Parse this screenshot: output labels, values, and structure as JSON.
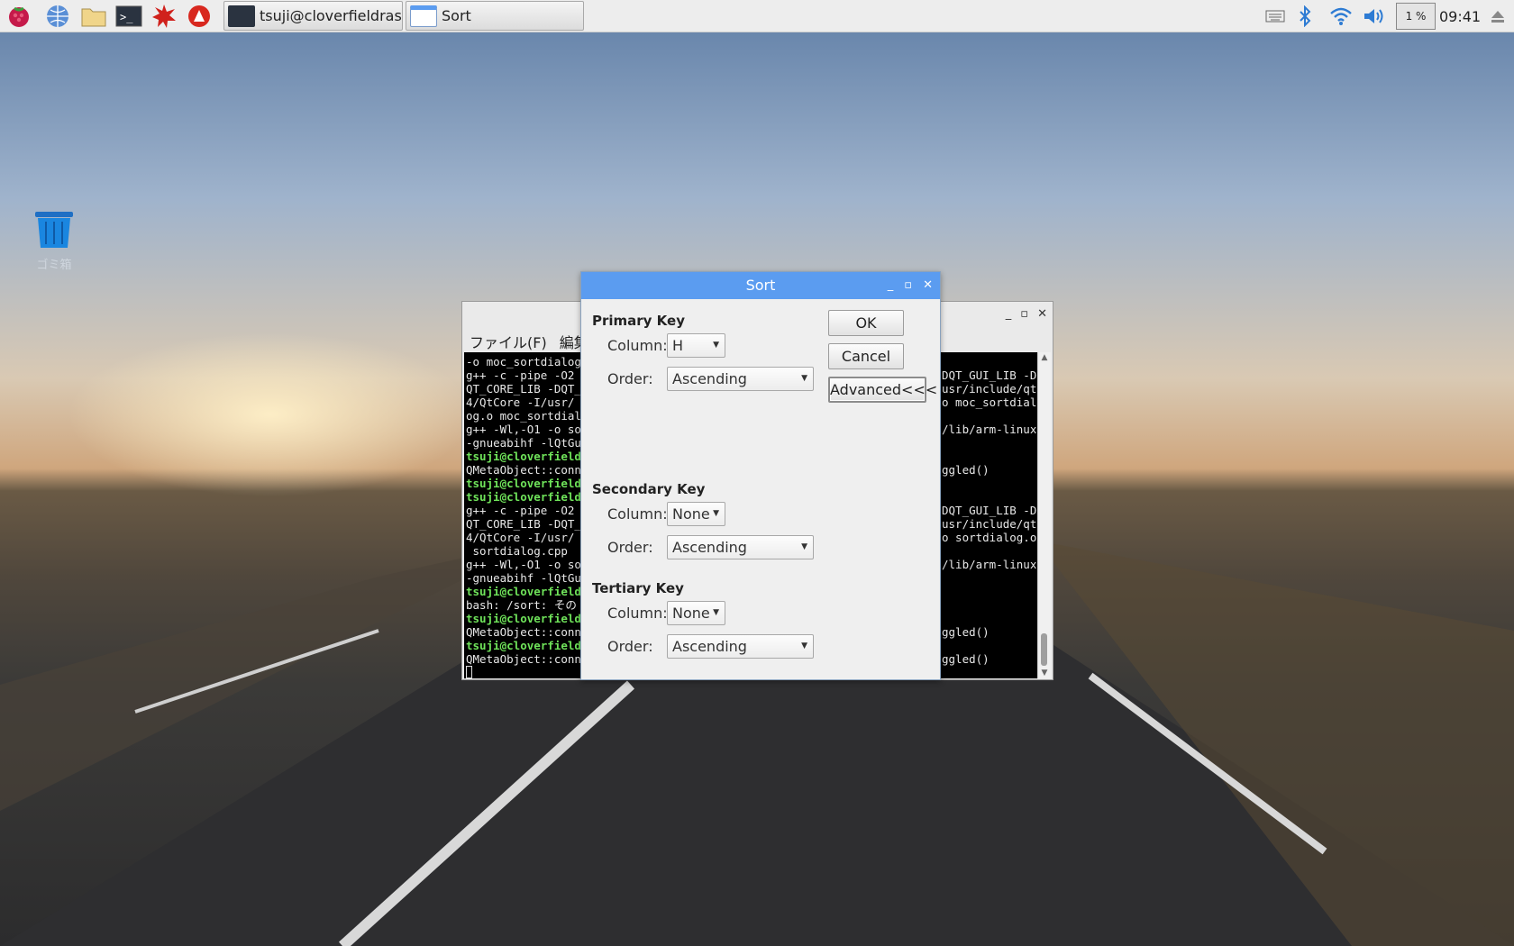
{
  "taskbar": {
    "tasks": [
      {
        "label": "tsuji@cloverfieldrasp..."
      },
      {
        "label": "Sort"
      }
    ],
    "cpu": "1 %",
    "clock": "09:41"
  },
  "desktop": {
    "trash_label": "ゴミ箱"
  },
  "terminal": {
    "menu": [
      "ファイル(F)",
      "編集"
    ],
    "left_lines": [
      {
        "t": "-o moc_sortdialog",
        "g": false
      },
      {
        "t": "g++ -c -pipe -O2",
        "g": false
      },
      {
        "t": "QT_CORE_LIB -DQT_",
        "g": false
      },
      {
        "t": "4/QtCore -I/usr/",
        "g": false
      },
      {
        "t": "og.o moc_sortdial",
        "g": false
      },
      {
        "t": "g++ -Wl,-O1 -o so",
        "g": false
      },
      {
        "t": "-gnueabihf -lQtGu",
        "g": false
      },
      {
        "t": "tsuji@cloverfield",
        "g": true
      },
      {
        "t": "QMetaObject::conn",
        "g": false
      },
      {
        "t": "tsuji@cloverfield",
        "g": true
      },
      {
        "t": "tsuji@cloverfield",
        "g": true
      },
      {
        "t": "g++ -c -pipe -O2",
        "g": false
      },
      {
        "t": "QT_CORE_LIB -DQT_",
        "g": false
      },
      {
        "t": "4/QtCore -I/usr/",
        "g": false
      },
      {
        "t": " sortdialog.cpp",
        "g": false
      },
      {
        "t": "g++ -Wl,-O1 -o so",
        "g": false
      },
      {
        "t": "-gnueabihf -lQtGu",
        "g": false
      },
      {
        "t": "tsuji@cloverfield",
        "g": true
      },
      {
        "t": "bash: /sort: その",
        "g": false
      },
      {
        "t": "tsuji@cloverfield",
        "g": true
      },
      {
        "t": "QMetaObject::conn",
        "g": false
      },
      {
        "t": "tsuji@cloverfield",
        "g": true
      },
      {
        "t": "QMetaObject::conn",
        "g": false
      }
    ],
    "right_lines": [
      {
        "row": 1,
        "t": "DQT_GUI_LIB -D"
      },
      {
        "row": 2,
        "t": "usr/include/qt"
      },
      {
        "row": 3,
        "t": "o moc_sortdial"
      },
      {
        "row": 5,
        "t": "/lib/arm-linux"
      },
      {
        "row": 8,
        "t": "ggled()"
      },
      {
        "row": 11,
        "t": "DQT_GUI_LIB -D"
      },
      {
        "row": 12,
        "t": "usr/include/qt"
      },
      {
        "row": 13,
        "t": "o sortdialog.o"
      },
      {
        "row": 15,
        "t": "/lib/arm-linux"
      },
      {
        "row": 20,
        "t": "ggled()"
      },
      {
        "row": 22,
        "t": "ggled()"
      }
    ]
  },
  "dialog": {
    "title": "Sort",
    "primary": {
      "heading": "Primary Key",
      "column_label": "Column:",
      "column_value": "H",
      "order_label": "Order:",
      "order_value": "Ascending"
    },
    "secondary": {
      "heading": "Secondary Key",
      "column_label": "Column:",
      "column_value": "None",
      "order_label": "Order:",
      "order_value": "Ascending"
    },
    "tertiary": {
      "heading": "Tertiary Key",
      "column_label": "Column:",
      "column_value": "None",
      "order_label": "Order:",
      "order_value": "Ascending"
    },
    "ok_label": "OK",
    "cancel_label": "Cancel",
    "advanced_label": "Advanced<<<"
  },
  "colors": {
    "dialog_titlebar": "#5b9cf0",
    "terminal_prompt": "#6fe35a"
  }
}
